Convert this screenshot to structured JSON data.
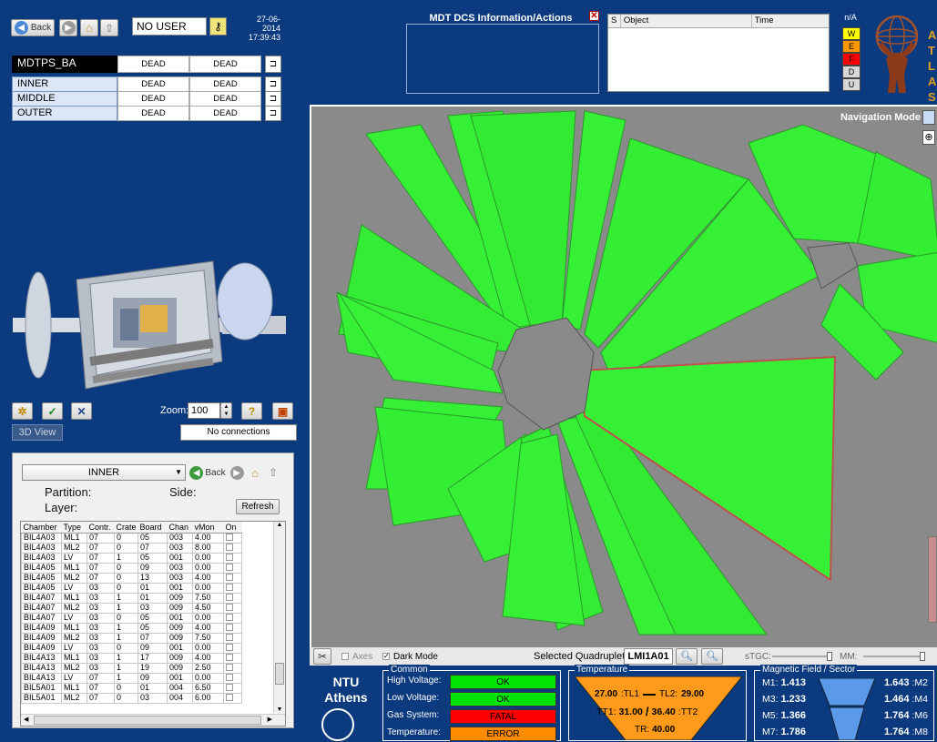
{
  "toolbar": {
    "back_label": "Back",
    "user": "NO USER",
    "date": "27-06-2014",
    "time": "17:39:43"
  },
  "state_table": {
    "top": {
      "name": "MDTPS_BA",
      "state1": "DEAD",
      "state2": "DEAD"
    },
    "rows": [
      {
        "name": "INNER",
        "state1": "DEAD",
        "state2": "DEAD"
      },
      {
        "name": "MIDDLE",
        "state1": "DEAD",
        "state2": "DEAD"
      },
      {
        "name": "OUTER",
        "state1": "DEAD",
        "state2": "DEAD"
      }
    ]
  },
  "info_panel": {
    "title": "MDT DCS Information/Actions"
  },
  "alarm": {
    "headers": [
      "S",
      "Object",
      "Time"
    ],
    "legend_title": "n/A",
    "legend": [
      {
        "code": "W",
        "color": "#ffff00"
      },
      {
        "code": "E",
        "color": "#ff9900"
      },
      {
        "code": "F",
        "color": "#ff0000"
      },
      {
        "code": "D",
        "color": "#d8d8d8"
      },
      {
        "code": "U",
        "color": "#d8d8d8"
      }
    ]
  },
  "logo": {
    "letters": [
      "A",
      "T",
      "L",
      "A",
      "S"
    ]
  },
  "view": {
    "nav_mode": "Navigation Mode",
    "zoom_label": "Zoom:",
    "zoom_value": "100",
    "view_btn": "3D View",
    "connections": "No connections"
  },
  "partition_panel": {
    "selected": "INNER",
    "back_label": "Back",
    "partition_label": "Partition:",
    "side_label": "Side:",
    "layer_label": "Layer:",
    "refresh": "Refresh",
    "columns": [
      "Chamber",
      "Type",
      "Contr.",
      "Crate",
      "Board",
      "Chan",
      "vMon",
      "On"
    ],
    "rows": [
      [
        "BIL4A03",
        "ML1",
        "07",
        "0",
        "05",
        "003",
        "4.00"
      ],
      [
        "BIL4A03",
        "ML2",
        "07",
        "0",
        "07",
        "003",
        "8.00"
      ],
      [
        "BIL4A03",
        "LV",
        "07",
        "1",
        "05",
        "001",
        "0.00"
      ],
      [
        "BIL4A05",
        "ML1",
        "07",
        "0",
        "09",
        "003",
        "0.00"
      ],
      [
        "BIL4A05",
        "ML2",
        "07",
        "0",
        "13",
        "003",
        "4.00"
      ],
      [
        "BIL4A05",
        "LV",
        "03",
        "0",
        "01",
        "001",
        "0.00"
      ],
      [
        "BIL4A07",
        "ML1",
        "03",
        "1",
        "01",
        "009",
        "7.50"
      ],
      [
        "BIL4A07",
        "ML2",
        "03",
        "1",
        "03",
        "009",
        "4.50"
      ],
      [
        "BIL4A07",
        "LV",
        "03",
        "0",
        "05",
        "001",
        "0.00"
      ],
      [
        "BIL4A09",
        "ML1",
        "03",
        "1",
        "05",
        "009",
        "4.00"
      ],
      [
        "BIL4A09",
        "ML2",
        "03",
        "1",
        "07",
        "009",
        "7.50"
      ],
      [
        "BIL4A09",
        "LV",
        "03",
        "0",
        "09",
        "001",
        "0.00"
      ],
      [
        "BIL4A13",
        "ML1",
        "03",
        "1",
        "17",
        "009",
        "4.00"
      ],
      [
        "BIL4A13",
        "ML2",
        "03",
        "1",
        "19",
        "009",
        "2.50"
      ],
      [
        "BIL4A13",
        "LV",
        "07",
        "1",
        "09",
        "001",
        "0.00"
      ],
      [
        "BIL5A01",
        "ML1",
        "07",
        "0",
        "01",
        "004",
        "6.50"
      ],
      [
        "BIL5A01",
        "ML2",
        "07",
        "0",
        "03",
        "004",
        "6.00"
      ]
    ]
  },
  "bottom_bar": {
    "axes_label": "Axes",
    "dark_mode_label": "Dark Mode",
    "selected_label": "Selected Quadruplet",
    "selected_value": "LMI1A01",
    "stgc_label": "sTGC:",
    "mm_label": "MM:"
  },
  "institute": {
    "line1": "NTU",
    "line2": "Athens"
  },
  "common": {
    "title": "Common",
    "items": [
      {
        "label": "High Voltage:",
        "value": "OK",
        "color": "#00e400"
      },
      {
        "label": "Low Voltage:",
        "value": "OK",
        "color": "#00e400"
      },
      {
        "label": "Gas System:",
        "value": "FATAL",
        "color": "#ff0000"
      },
      {
        "label": "Temperature:",
        "value": "ERROR",
        "color": "#ff8c00"
      }
    ]
  },
  "temperature": {
    "title": "Temperature",
    "tl1_val": "27.00",
    "tl1": ":TL1",
    "tl2": "TL2:",
    "tl2_val": "29.00",
    "tt1": "TT1:",
    "tt1_val": "31.00",
    "tt2_val": "36.40",
    "tt2": ":TT2",
    "tr": "TR:",
    "tr_val": "40.00"
  },
  "magnetic": {
    "title": "Magnetic Field / Sector",
    "left": [
      {
        "label": "M1:",
        "value": "1.413"
      },
      {
        "label": "M3:",
        "value": "1.233"
      },
      {
        "label": "M5:",
        "value": "1.366"
      },
      {
        "label": "M7:",
        "value": "1.786"
      }
    ],
    "right": [
      {
        "label": ":M2",
        "value": "1.643"
      },
      {
        "label": ":M4",
        "value": "1.464"
      },
      {
        "label": ":M6",
        "value": "1.764"
      },
      {
        "label": ":M8",
        "value": "1.764"
      }
    ]
  }
}
